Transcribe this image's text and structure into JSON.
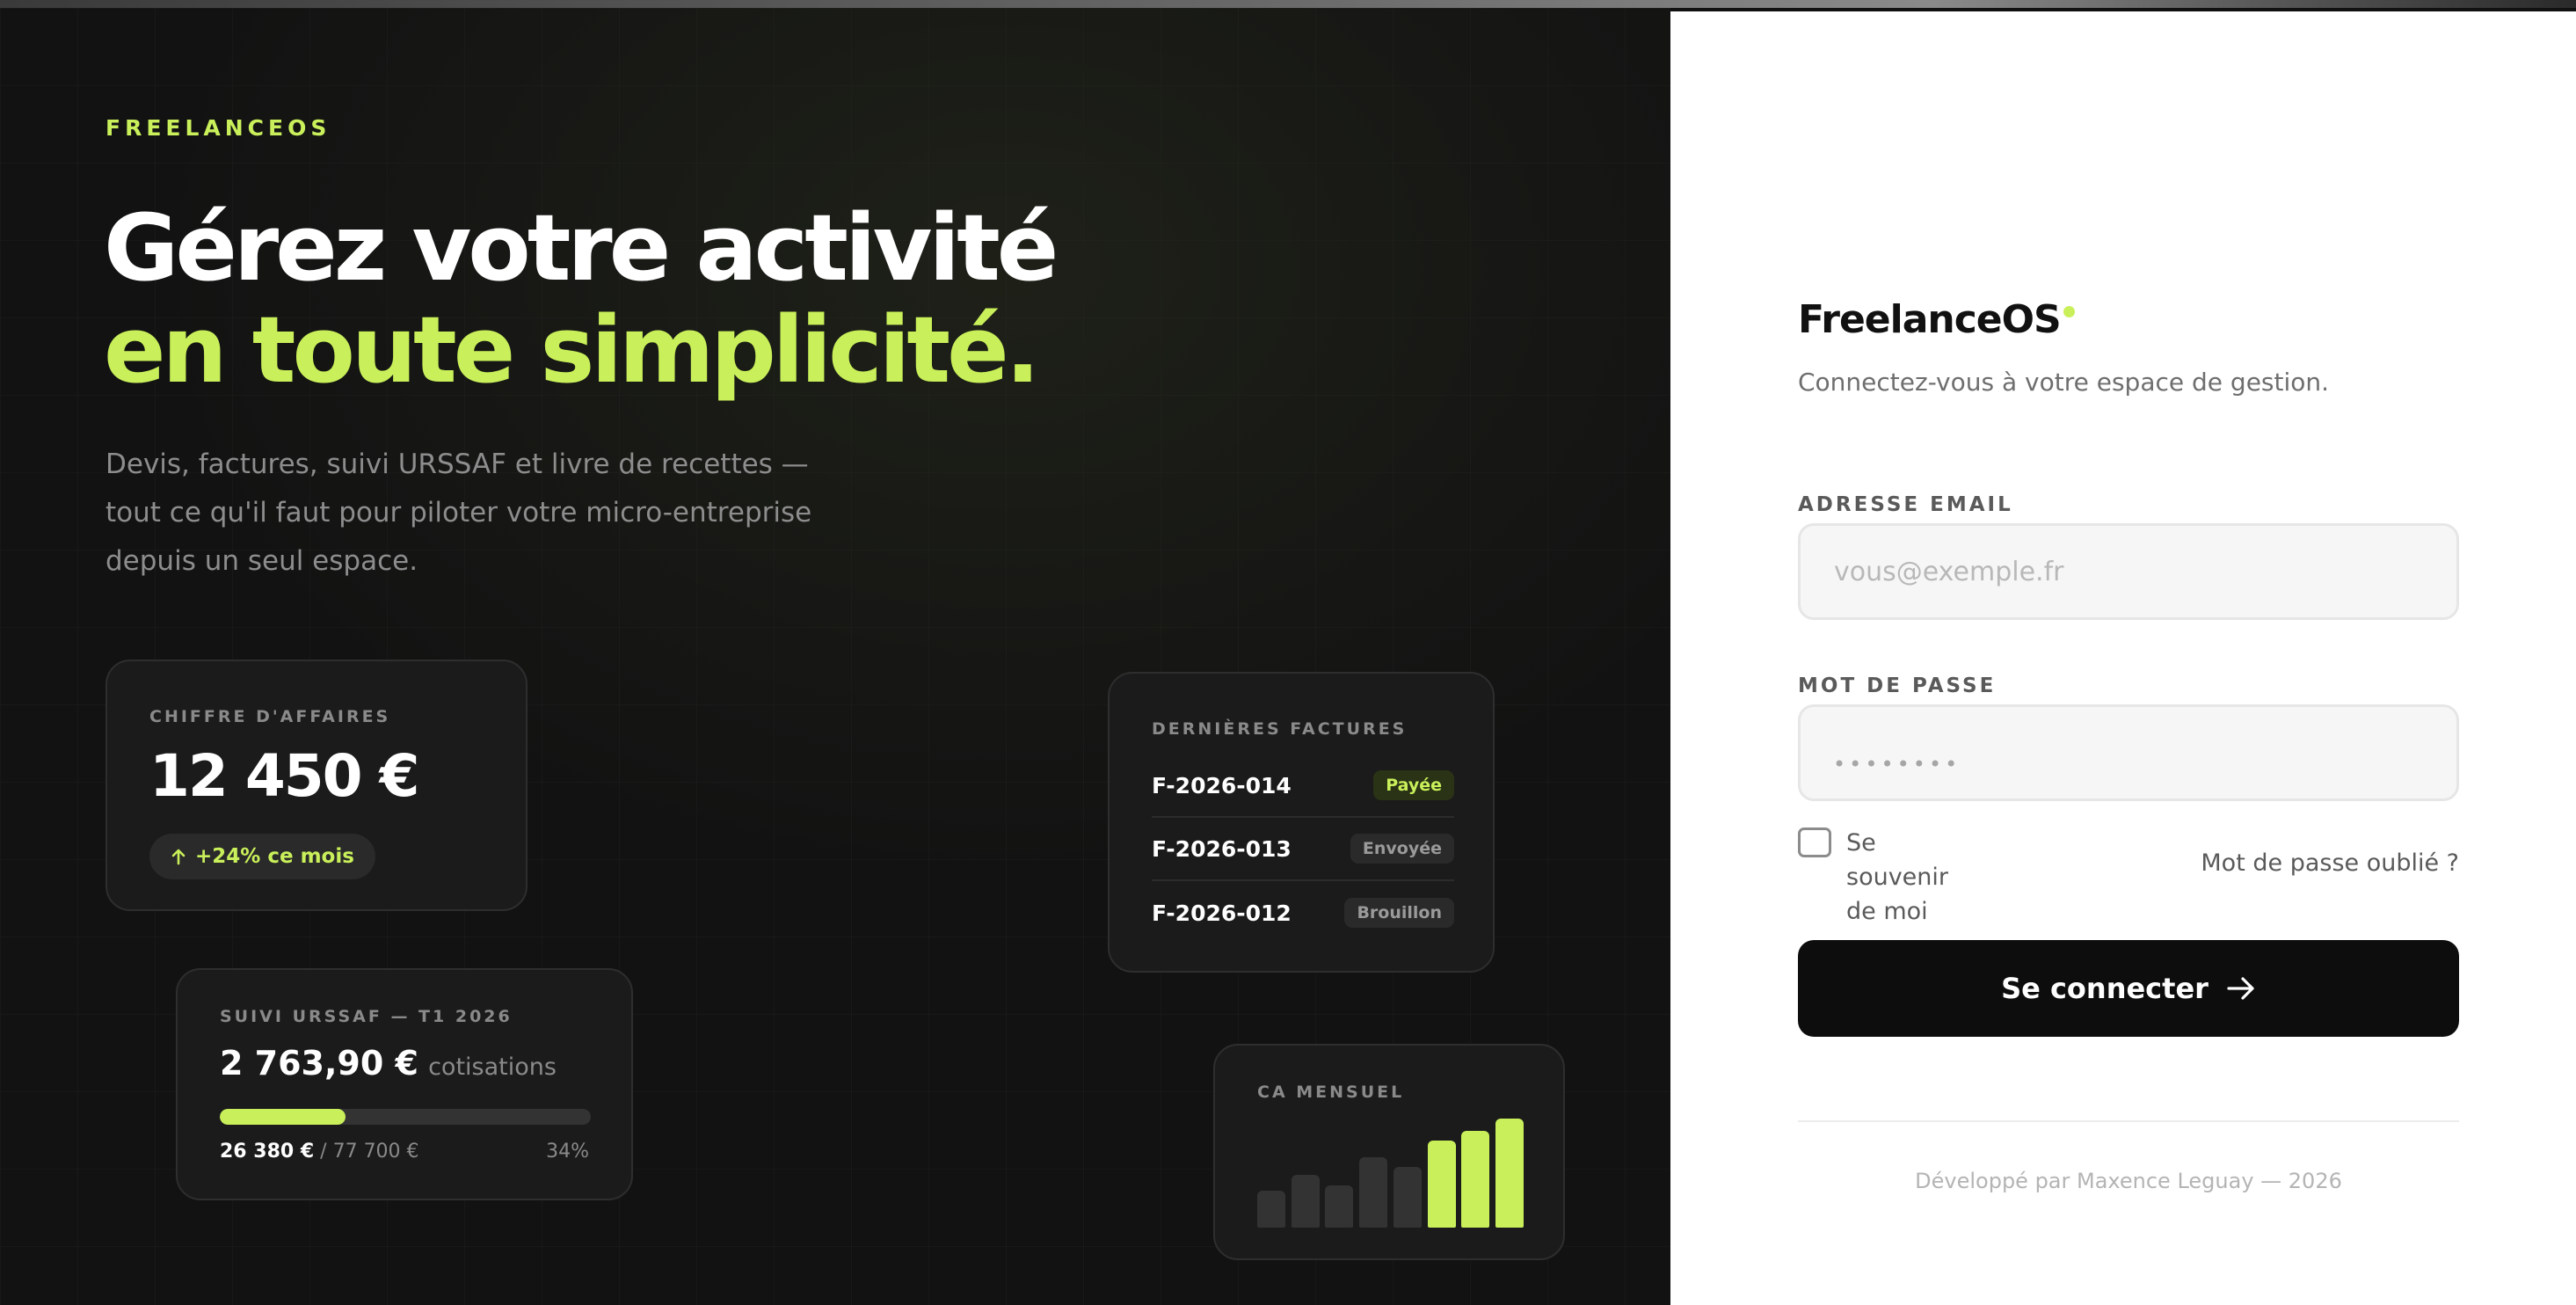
{
  "hero": {
    "brand": "FREELANCEOS",
    "headline_line1": "Gérez votre activité",
    "headline_line2": "en toute simplicité.",
    "subtitle": "Devis, factures, suivi URSSAF et livre de recettes — tout ce qu'il faut pour piloter votre micro-entreprise depuis un seul espace."
  },
  "cards": {
    "revenue": {
      "label": "CHIFFRE D'AFFAIRES",
      "value": "12 450 €",
      "trend": "+24% ce mois",
      "trend_icon": "arrow-up-icon"
    },
    "urssaf": {
      "label": "SUIVI URSSAF — T1 2026",
      "amount": "2 763,90 €",
      "amount_unit": "cotisations",
      "progress_current": "26 380 €",
      "progress_total": "/ 77 700 €",
      "progress_percent": "34%",
      "progress_fraction": 0.34
    },
    "invoices": {
      "label": "DERNIÈRES FACTURES",
      "items": [
        {
          "id": "F-2026-014",
          "status": "Payée",
          "state": "paid"
        },
        {
          "id": "F-2026-013",
          "status": "Envoyée",
          "state": "sent"
        },
        {
          "id": "F-2026-012",
          "status": "Brouillon",
          "state": "draft"
        }
      ]
    },
    "monthly": {
      "label": "CA MENSUEL",
      "bars": [
        0.33,
        0.47,
        0.38,
        0.63,
        0.54,
        0.78,
        0.87,
        0.98
      ],
      "highlighted_from": 5
    }
  },
  "login": {
    "logo": "FreelanceOS",
    "tagline": "Connectez-vous à votre espace de gestion.",
    "email_label": "ADRESSE EMAIL",
    "email_placeholder": "vous@exemple.fr",
    "password_label": "MOT DE PASSE",
    "password_placeholder": "••••••••",
    "remember_label": "Se souvenir de moi",
    "forgot_label": "Mot de passe oublié ?",
    "submit_label": "Se connecter",
    "footer": "Développé par Maxence Leguay — 2026"
  },
  "colors": {
    "accent": "#c9f05a",
    "dark_bg": "#121212",
    "card_bg": "#1b1b1b",
    "bar_dim": "#333333",
    "button": "#0d0d0d"
  }
}
